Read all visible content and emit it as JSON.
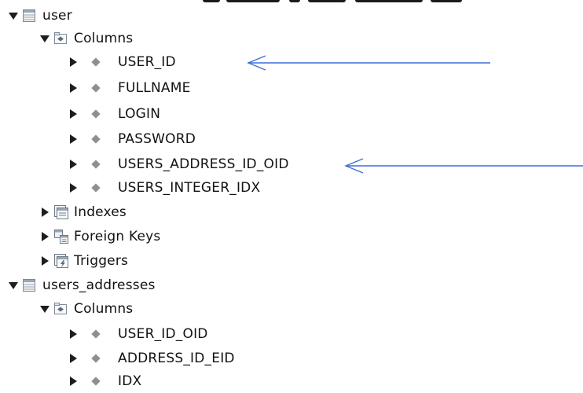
{
  "tree": {
    "tables": [
      {
        "name": "user",
        "icon": "table-icon",
        "expanded": true,
        "columns_folder": {
          "label": "Columns",
          "icon": "columns-folder-icon",
          "expanded": true,
          "items": [
            {
              "label": "USER_ID"
            },
            {
              "label": "FULLNAME"
            },
            {
              "label": "LOGIN"
            },
            {
              "label": "PASSWORD"
            },
            {
              "label": "USERS_ADDRESS_ID_OID"
            },
            {
              "label": "USERS_INTEGER_IDX"
            }
          ]
        },
        "other_folders": [
          {
            "label": "Indexes",
            "icon": "indexes-icon"
          },
          {
            "label": "Foreign Keys",
            "icon": "foreign-keys-icon"
          },
          {
            "label": "Triggers",
            "icon": "triggers-icon"
          }
        ]
      },
      {
        "name": "users_addresses",
        "icon": "table-icon",
        "expanded": true,
        "columns_folder": {
          "label": "Columns",
          "icon": "columns-folder-icon",
          "expanded": true,
          "items": [
            {
              "label": "USER_ID_OID"
            },
            {
              "label": "ADDRESS_ID_EID"
            },
            {
              "label": "IDX"
            }
          ]
        }
      }
    ]
  },
  "annotations": [
    {
      "target": "USER_ID",
      "icon": "arrow-left-icon",
      "color": "#3f6fd9"
    },
    {
      "target": "USERS_ADDRESS_ID_OID",
      "icon": "arrow-left-icon",
      "color": "#3f6fd9"
    }
  ],
  "colors": {
    "text": "#111111",
    "expander": "#1e1e1e",
    "column_diamond": "#8c9096",
    "annotation_arrow": "#3f6fd9"
  }
}
